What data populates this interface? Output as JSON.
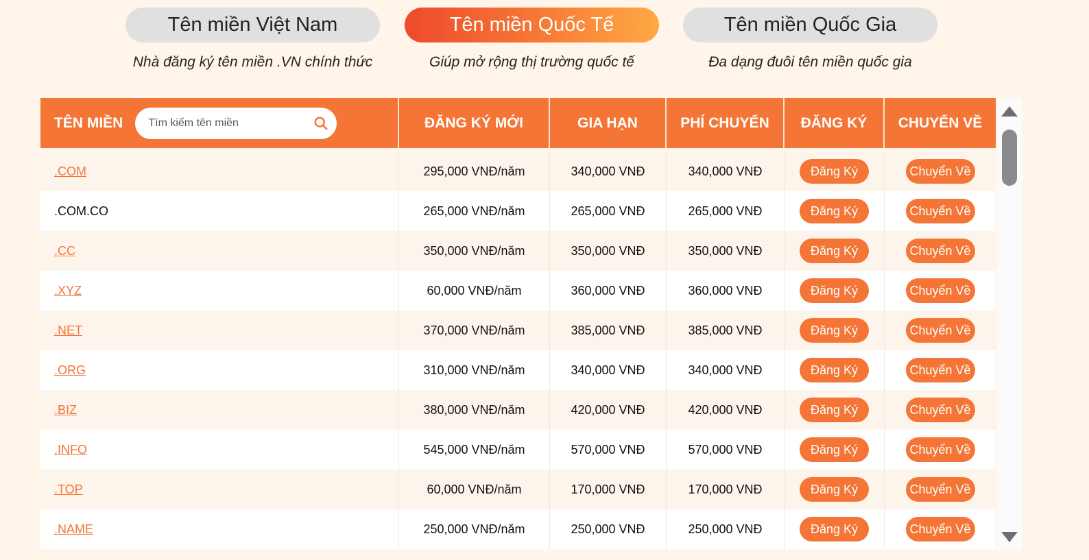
{
  "tabs": [
    {
      "label": "Tên miền Việt Nam",
      "subtitle": "Nhà đăng ký tên miền .VN chính thức",
      "active": false
    },
    {
      "label": "Tên miền Quốc Tế",
      "subtitle": "Giúp mở rộng thị trường quốc tế",
      "active": true
    },
    {
      "label": "Tên miền Quốc Gia",
      "subtitle": "Đa dạng đuôi tên miền quốc gia",
      "active": false
    }
  ],
  "table": {
    "headers": {
      "domain": "TÊN MIỀN",
      "new": "ĐĂNG KÝ MỚI",
      "renew": "GIA HẠN",
      "transfer_fee": "PHÍ CHUYỂN",
      "register": "ĐĂNG KÝ",
      "transfer": "CHUYỂN VỀ"
    },
    "search_placeholder": "Tìm kiếm tên miền",
    "search_icon": "search-icon",
    "register_label": "Đăng Ký",
    "transfer_label": "Chuyển Về",
    "rows": [
      {
        "domain": ".COM",
        "link": true,
        "new": "295,000 VNĐ/năm",
        "renew": "340,000 VNĐ",
        "transfer_fee": "340,000 VNĐ"
      },
      {
        "domain": ".COM.CO",
        "link": false,
        "new": "265,000 VNĐ/năm",
        "renew": "265,000 VNĐ",
        "transfer_fee": "265,000 VNĐ"
      },
      {
        "domain": ".CC",
        "link": true,
        "new": "350,000 VNĐ/năm",
        "renew": "350,000 VNĐ",
        "transfer_fee": "350,000 VNĐ"
      },
      {
        "domain": ".XYZ",
        "link": true,
        "new": "60,000 VNĐ/năm",
        "renew": "360,000 VNĐ",
        "transfer_fee": "360,000 VNĐ"
      },
      {
        "domain": ".NET",
        "link": true,
        "new": "370,000 VNĐ/năm",
        "renew": "385,000 VNĐ",
        "transfer_fee": "385,000 VNĐ"
      },
      {
        "domain": ".ORG",
        "link": true,
        "new": "310,000 VNĐ/năm",
        "renew": "340,000 VNĐ",
        "transfer_fee": "340,000 VNĐ"
      },
      {
        "domain": ".BIZ",
        "link": true,
        "new": "380,000 VNĐ/năm",
        "renew": "420,000 VNĐ",
        "transfer_fee": "420,000 VNĐ"
      },
      {
        "domain": ".INFO",
        "link": true,
        "new": "545,000 VNĐ/năm",
        "renew": "570,000 VNĐ",
        "transfer_fee": "570,000 VNĐ"
      },
      {
        "domain": ".TOP",
        "link": true,
        "new": "60,000 VNĐ/năm",
        "renew": "170,000 VNĐ",
        "transfer_fee": "170,000 VNĐ"
      },
      {
        "domain": ".NAME",
        "link": true,
        "new": "250,000 VNĐ/năm",
        "renew": "250,000 VNĐ",
        "transfer_fee": "250,000 VNĐ"
      }
    ]
  },
  "colors": {
    "accent": "#f47535",
    "page_bg": "#fff5ea",
    "tab_inactive": "#e0e0e0"
  }
}
